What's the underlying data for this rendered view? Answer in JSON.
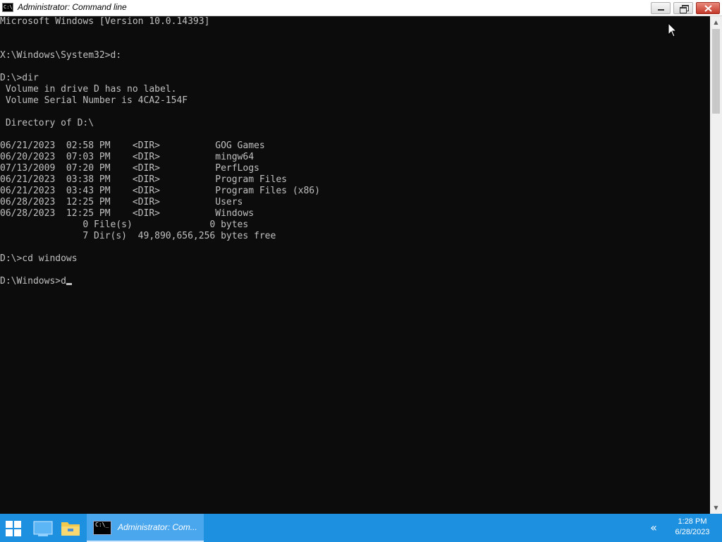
{
  "window": {
    "title": "Administrator: Command line",
    "icon": "cmd-icon"
  },
  "console": {
    "lines": [
      "Microsoft Windows [Version 10.0.14393]",
      "",
      "",
      "X:\\Windows\\System32>d:",
      "",
      "D:\\>dir",
      " Volume in drive D has no label.",
      " Volume Serial Number is 4CA2-154F",
      "",
      " Directory of D:\\",
      "",
      "06/21/2023  02:58 PM    <DIR>          GOG Games",
      "06/20/2023  07:03 PM    <DIR>          mingw64",
      "07/13/2009  07:20 PM    <DIR>          PerfLogs",
      "06/21/2023  03:38 PM    <DIR>          Program Files",
      "06/21/2023  03:43 PM    <DIR>          Program Files (x86)",
      "06/28/2023  12:25 PM    <DIR>          Users",
      "06/28/2023  12:25 PM    <DIR>          Windows",
      "               0 File(s)              0 bytes",
      "               7 Dir(s)  49,890,656,256 bytes free",
      "",
      "D:\\>cd windows",
      ""
    ],
    "prompt": "D:\\Windows>",
    "input": "d"
  },
  "taskbar": {
    "start_icon": "windows-start-icon",
    "pinned": [
      "file-explorer-icon",
      "folder-icon"
    ],
    "task_label": "Administrator: Com...",
    "time": "1:28 PM",
    "date": "6/28/2023"
  },
  "colors": {
    "console_bg": "#0c0c0c",
    "console_fg": "#c0c0c0",
    "taskbar": "#1e90e0"
  }
}
